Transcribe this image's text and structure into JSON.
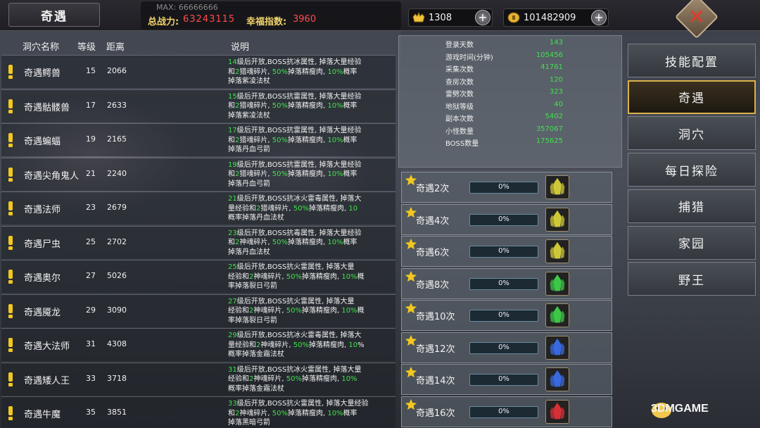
{
  "header": {
    "tab_title": "奇遇",
    "max_label": "MAX: 66666666",
    "power_label": "总战力:",
    "power_value": "63243115",
    "luck_label": "幸福指数:",
    "luck_value": "3960",
    "gold_value": "1308",
    "coin_value": "101482909"
  },
  "table": {
    "headers": {
      "name": "洞穴名称",
      "level": "等级",
      "distance": "距离",
      "desc": "说明"
    },
    "rows": [
      {
        "name": "奇遇鳄兽",
        "level": "15",
        "distance": "2066",
        "desc": [
          [
            "g",
            "14"
          ],
          [
            "t",
            "级后开放,BOSS抗冰属性, 掉落大量经验\n和"
          ],
          [
            "g",
            "2"
          ],
          [
            "t",
            "猎魂碎片, "
          ],
          [
            "g",
            "50%"
          ],
          [
            "t",
            "掉落精瘦肉, "
          ],
          [
            "g",
            "10%"
          ],
          [
            "t",
            "概率\n掉落紫凌法杖"
          ]
        ]
      },
      {
        "name": "奇遇骷髅兽",
        "level": "17",
        "distance": "2633",
        "desc": [
          [
            "g",
            "15"
          ],
          [
            "t",
            "级后开放,BOSS抗雷属性, 掉落大量经验\n和"
          ],
          [
            "g",
            "2"
          ],
          [
            "t",
            "猎魂碎片, "
          ],
          [
            "g",
            "50%"
          ],
          [
            "t",
            "掉落精瘦肉, "
          ],
          [
            "g",
            "10%"
          ],
          [
            "t",
            "概率\n掉落紫凌法杖"
          ]
        ]
      },
      {
        "name": "奇遇蝙蝠",
        "level": "19",
        "distance": "2165",
        "desc": [
          [
            "g",
            "17"
          ],
          [
            "t",
            "级后开放,BOSS抗雷属性, 掉落大量经验\n和"
          ],
          [
            "g",
            "2"
          ],
          [
            "t",
            "猎魂碎片, "
          ],
          [
            "g",
            "50%"
          ],
          [
            "t",
            "掉落精瘦肉, "
          ],
          [
            "g",
            "10%"
          ],
          [
            "t",
            "概率\n掉落丹血弓箭"
          ]
        ]
      },
      {
        "name": "奇遇尖角鬼人",
        "level": "21",
        "distance": "2240",
        "desc": [
          [
            "g",
            "19"
          ],
          [
            "t",
            "级后开放,BOSS抗雷属性, 掉落大量经验\n和"
          ],
          [
            "g",
            "2"
          ],
          [
            "t",
            "猎魂碎片, "
          ],
          [
            "g",
            "50%"
          ],
          [
            "t",
            "掉落精瘦肉, "
          ],
          [
            "g",
            "10%"
          ],
          [
            "t",
            "概率\n掉落丹血弓箭"
          ]
        ]
      },
      {
        "name": "奇遇法师",
        "level": "23",
        "distance": "2679",
        "desc": [
          [
            "g",
            "21"
          ],
          [
            "t",
            "级后开放,BOSS抗冰火雷毒属性, 掉落大\n量经验和"
          ],
          [
            "g",
            "2"
          ],
          [
            "t",
            "猎魂碎片, "
          ],
          [
            "g",
            "50%"
          ],
          [
            "t",
            "掉落精瘦肉, "
          ],
          [
            "g",
            "10"
          ],
          [
            "t",
            "\n概率掉落丹血法杖"
          ]
        ]
      },
      {
        "name": "奇遇尸虫",
        "level": "25",
        "distance": "2702",
        "desc": [
          [
            "g",
            "23"
          ],
          [
            "t",
            "级后开放,BOSS抗毒属性, 掉落大量经验\n和"
          ],
          [
            "g",
            "2"
          ],
          [
            "t",
            "神魂碎片, "
          ],
          [
            "g",
            "50%"
          ],
          [
            "t",
            "掉落精瘦肉, "
          ],
          [
            "g",
            "10%"
          ],
          [
            "t",
            "概率\n掉落丹血法杖"
          ]
        ]
      },
      {
        "name": "奇遇奥尔",
        "level": "27",
        "distance": "5026",
        "desc": [
          [
            "g",
            "25"
          ],
          [
            "t",
            "级后开放,BOSS抗火雷属性, 掉落大量\n经验和"
          ],
          [
            "g",
            "2"
          ],
          [
            "t",
            "神魂碎片, "
          ],
          [
            "g",
            "50%"
          ],
          [
            "t",
            "掉落精瘦肉, "
          ],
          [
            "g",
            "10%"
          ],
          [
            "t",
            "概\n率掉落裂日弓箭"
          ]
        ]
      },
      {
        "name": "奇遇魇龙",
        "level": "29",
        "distance": "3090",
        "desc": [
          [
            "g",
            "27"
          ],
          [
            "t",
            "级后开放,BOSS抗火雷属性, 掉落大量\n经验和"
          ],
          [
            "g",
            "2"
          ],
          [
            "t",
            "神魂碎片, "
          ],
          [
            "g",
            "50%"
          ],
          [
            "t",
            "掉落精瘦肉, "
          ],
          [
            "g",
            "10%"
          ],
          [
            "t",
            "概\n率掉落裂日弓箭"
          ]
        ]
      },
      {
        "name": "奇遇大法师",
        "level": "31",
        "distance": "4308",
        "desc": [
          [
            "g",
            "29"
          ],
          [
            "t",
            "级后开放,BOSS抗冰火雷毒属性, 掉落大\n量经验和"
          ],
          [
            "g",
            "2"
          ],
          [
            "t",
            "神魂碎片, "
          ],
          [
            "g",
            "50%"
          ],
          [
            "t",
            "掉落精瘦肉, "
          ],
          [
            "g",
            "10"
          ],
          [
            "t",
            "%\n概率掉落金霜法杖"
          ]
        ]
      },
      {
        "name": "奇遇矮人王",
        "level": "33",
        "distance": "3718",
        "desc": [
          [
            "g",
            "31"
          ],
          [
            "t",
            "级后开放,BOSS抗冰火雷属性, 掉落大量\n经验和"
          ],
          [
            "g",
            "2"
          ],
          [
            "t",
            "神魂碎片, "
          ],
          [
            "g",
            "50%"
          ],
          [
            "t",
            "掉落精瘦肉, "
          ],
          [
            "g",
            "10%"
          ],
          [
            "t",
            "\n概率掉落金霜法杖"
          ]
        ]
      },
      {
        "name": "奇遇牛魔",
        "level": "35",
        "distance": "3851",
        "desc": [
          [
            "g",
            "33"
          ],
          [
            "t",
            "级后开放,BOSS抗火雷属性, 掉落大量经验\n和"
          ],
          [
            "g",
            "2"
          ],
          [
            "t",
            "神魂碎片, "
          ],
          [
            "g",
            "50%"
          ],
          [
            "t",
            "掉落精瘦肉, "
          ],
          [
            "g",
            "10%"
          ],
          [
            "t",
            "概率\n掉落黑暗弓箭"
          ]
        ]
      }
    ]
  },
  "stats": [
    {
      "label": "登录天数",
      "value": "143"
    },
    {
      "label": "游戏时间(分钟)",
      "value": "105456"
    },
    {
      "label": "采集次数",
      "value": "41761"
    },
    {
      "label": "查房次数",
      "value": "120"
    },
    {
      "label": "雷劈次数",
      "value": "323"
    },
    {
      "label": "地狱等级",
      "value": "40"
    },
    {
      "label": "副本次数",
      "value": "5402"
    },
    {
      "label": "小怪数量",
      "value": "357067"
    },
    {
      "label": "BOSS数量",
      "value": "175625"
    }
  ],
  "achievements": [
    {
      "label": "奇遇2次",
      "percent": "0%",
      "progress": 0,
      "crystal": "yellow"
    },
    {
      "label": "奇遇4次",
      "percent": "0%",
      "progress": 0,
      "crystal": "yellow"
    },
    {
      "label": "奇遇6次",
      "percent": "0%",
      "progress": 0,
      "crystal": "yellow"
    },
    {
      "label": "奇遇8次",
      "percent": "0%",
      "progress": 0,
      "crystal": "green"
    },
    {
      "label": "奇遇10次",
      "percent": "0%",
      "progress": 0,
      "crystal": "green"
    },
    {
      "label": "奇遇12次",
      "percent": "0%",
      "progress": 0,
      "crystal": "blue"
    },
    {
      "label": "奇遇14次",
      "percent": "0%",
      "progress": 0,
      "crystal": "blue"
    },
    {
      "label": "奇遇16次",
      "percent": "0%",
      "progress": 0,
      "crystal": "red"
    }
  ],
  "crystal_colors": {
    "yellow": "#d8d23a",
    "green": "#3fd04a",
    "blue": "#3a6ee8",
    "red": "#e0303a"
  },
  "menu": [
    {
      "label": "技能配置",
      "active": false
    },
    {
      "label": "奇遇",
      "active": true
    },
    {
      "label": "洞穴",
      "active": false
    },
    {
      "label": "每日探险",
      "active": false
    },
    {
      "label": "捕猎",
      "active": false
    },
    {
      "label": "家园",
      "active": false
    },
    {
      "label": "野王",
      "active": false
    }
  ],
  "watermark": "3DMGAME"
}
